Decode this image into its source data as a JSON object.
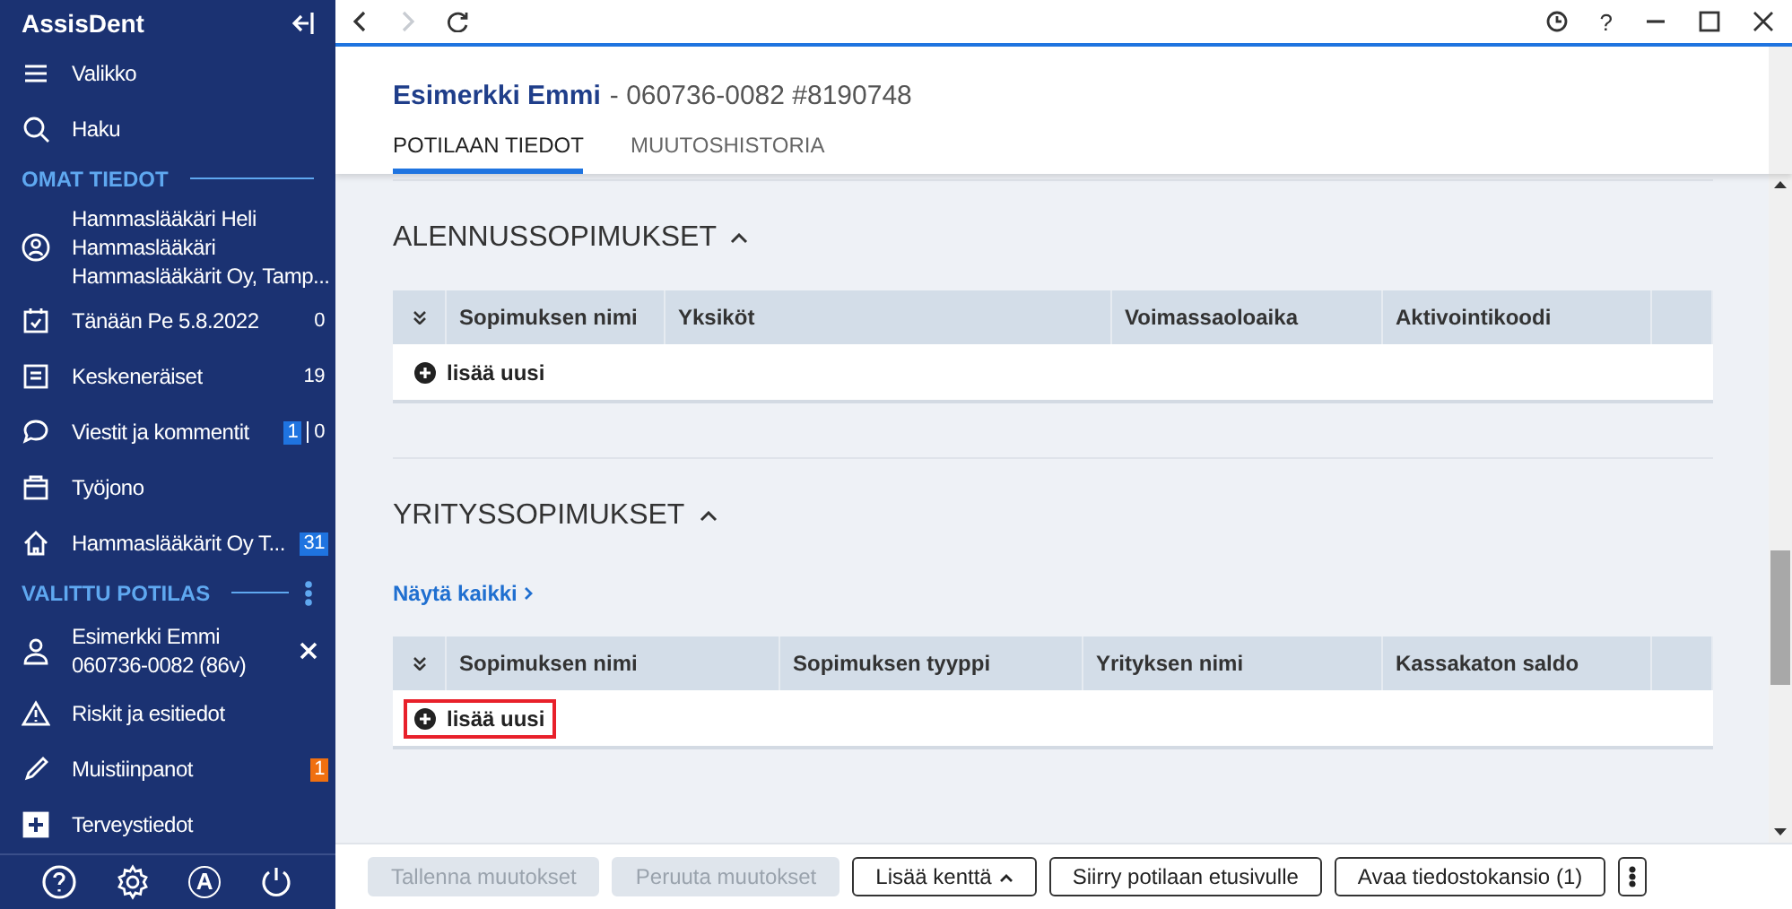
{
  "app": {
    "title": "AssisDent"
  },
  "sidebar": {
    "items": [
      {
        "kind": "link",
        "label": "Valikko"
      },
      {
        "kind": "link",
        "label": "Haku"
      },
      {
        "kind": "section",
        "label": "OMAT TIEDOT",
        "menu": false
      },
      {
        "kind": "multi",
        "lines": [
          "Hammaslääkäri Heli",
          "Hammaslääkäri",
          "Hammaslääkärit Oy, Tamp..."
        ]
      },
      {
        "kind": "link",
        "label": "Tänään Pe 5.8.2022",
        "count": "0"
      },
      {
        "kind": "link",
        "label": "Keskeneräiset",
        "count": "19"
      },
      {
        "kind": "link",
        "label": "Viestit ja kommentit",
        "badge": {
          "text": "1",
          "color": "#1f74e0"
        },
        "count": "0"
      },
      {
        "kind": "link",
        "label": "Työjono"
      },
      {
        "kind": "link",
        "label": "Hammaslääkärit Oy T...",
        "badge": {
          "text": "31",
          "color": "#1f74e0"
        }
      },
      {
        "kind": "section",
        "label": "VALITTU POTILAS",
        "menu": true
      },
      {
        "kind": "multi",
        "lines": [
          "Esimerkki Emmi",
          "060736-0082 (86v)"
        ],
        "closable": true
      },
      {
        "kind": "link",
        "label": "Riskit ja esitiedot"
      },
      {
        "kind": "link",
        "label": "Muistiinpanot",
        "badge": {
          "text": "1",
          "color": "#f07010"
        }
      },
      {
        "kind": "link",
        "label": "Terveystiedot"
      }
    ],
    "footer": {
      "account_letter": "A"
    }
  },
  "toolbar": {
    "back_disabled": false,
    "forward_disabled": true,
    "help_glyph": "?"
  },
  "patient": {
    "name": "Esimerkki Emmi",
    "details": "- 060736-0082 #8190748"
  },
  "tabs": [
    {
      "label": "POTILAAN TIEDOT",
      "selected": true
    },
    {
      "label": "MUUTOSHISTORIA",
      "selected": false
    }
  ],
  "sections": [
    {
      "title": "ALENNUSSOPIMUKSET",
      "expanded": true,
      "columns": [
        "Sopimuksen nimi",
        "Yksiköt",
        "Voimassaoloaika",
        "Aktivointikoodi"
      ],
      "add_label": "lisää uusi",
      "highlighted": false
    },
    {
      "title": "YRITYSSOPIMUKSET",
      "expanded": true,
      "link": "Näytä kaikki",
      "columns": [
        "Sopimuksen nimi",
        "Sopimuksen tyyppi",
        "Yrityksen nimi",
        "Kassakaton saldo"
      ],
      "add_label": "lisää uusi",
      "highlighted": true
    }
  ],
  "actions": [
    {
      "label": "Tallenna muutokset",
      "disabled": true
    },
    {
      "label": "Peruuta muutokset",
      "disabled": true
    },
    {
      "label": "Lisää kenttä",
      "disabled": false,
      "caret": true
    },
    {
      "label": "Siirry potilaan etusivulle",
      "disabled": false
    },
    {
      "label": "Avaa tiedostokansio (1)",
      "disabled": false
    },
    {
      "kind": "more",
      "disabled": false
    }
  ]
}
